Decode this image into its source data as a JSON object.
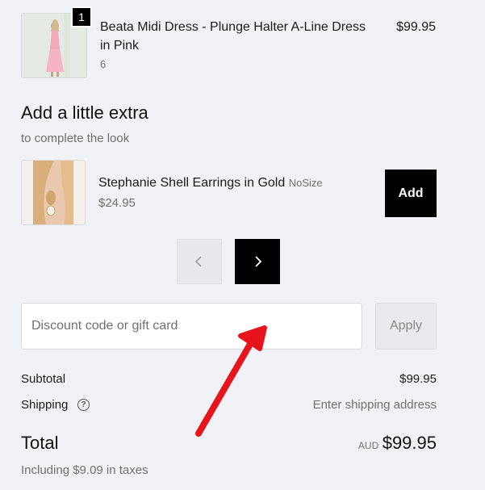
{
  "line_item": {
    "quantity": "1",
    "title_line1": "Beata Midi Dress - Plunge Halter A-Line Dress",
    "title_line2": "in Pink",
    "variant": "6",
    "price": "$99.95",
    "image_icon": "pink-dress-photo"
  },
  "upsell": {
    "heading": "Add a little extra",
    "subheading": "to complete the look",
    "product_name": "Stephanie Shell Earrings in Gold",
    "size": "NoSize",
    "price": "$24.95",
    "add_label": "Add",
    "image_icon": "earrings-photo"
  },
  "carousel": {
    "prev_icon": "chevron-left-icon",
    "next_icon": "chevron-right-icon"
  },
  "discount": {
    "placeholder": "Discount code or gift card",
    "apply_label": "Apply"
  },
  "summary": {
    "subtotal_label": "Subtotal",
    "subtotal_value": "$99.95",
    "shipping_label": "Shipping",
    "shipping_value": "Enter shipping address",
    "help_glyph": "?",
    "total_label": "Total",
    "currency": "AUD",
    "total_value": "$99.95",
    "taxes_note": "Including $9.09 in taxes"
  },
  "annotation": {
    "arrow_color": "#e8141c"
  }
}
